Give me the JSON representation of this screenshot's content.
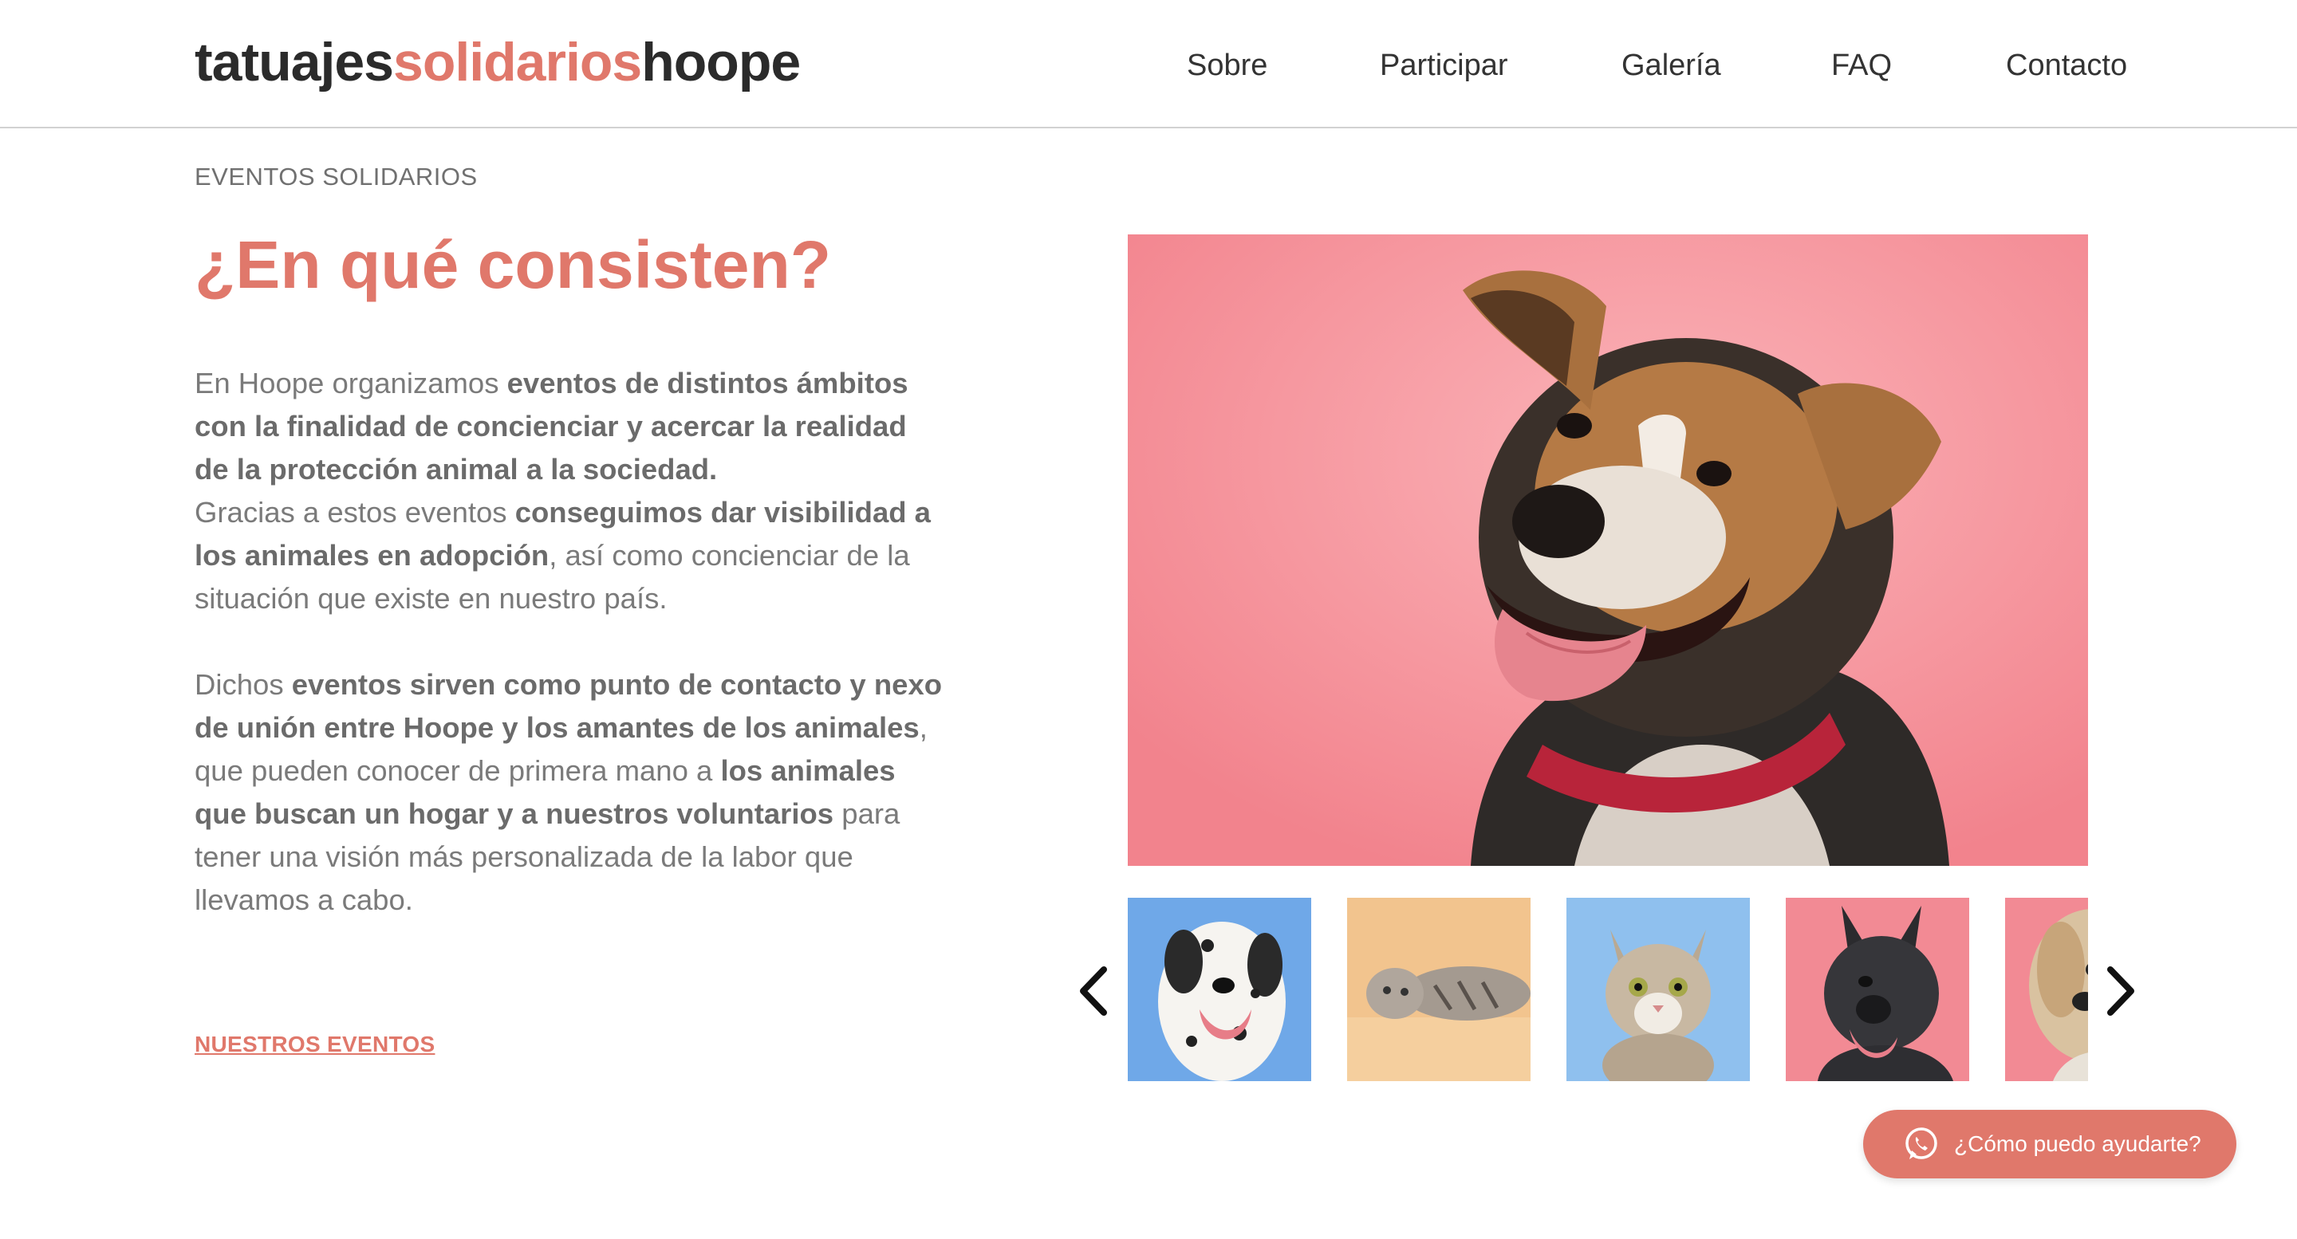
{
  "header": {
    "logo": {
      "part1": "tatuajes",
      "part2": "solidarios",
      "part3": "hoope"
    },
    "nav": [
      {
        "label": "Sobre"
      },
      {
        "label": "Participar"
      },
      {
        "label": "Galería"
      },
      {
        "label": "FAQ"
      },
      {
        "label": "Contacto"
      }
    ]
  },
  "section": {
    "eyebrow": "EVENTOS SOLIDARIOS",
    "title": "¿En qué consisten?",
    "paragraph1": {
      "t1": "En Hoope organizamos ",
      "b1": "eventos de distintos ámbitos con la finalidad de concienciar y acercar la realidad de la protección animal a la sociedad.",
      "t2": "Gracias a estos eventos ",
      "b2": "conseguimos dar visibilidad a los animales en adopción",
      "t3": ", así como concienciar de la situación que existe en nuestro país."
    },
    "paragraph2": {
      "t1": "Dichos ",
      "b1": "eventos sirven como punto de contacto y nexo de unión entre Hoope y los amantes de los animales",
      "t2": ", que pueden conocer de primera mano a ",
      "b2": "los animales que buscan un hogar y a nuestros voluntarios",
      "t3": " para tener una visión más personalizada de la labor que llevamos a cabo."
    },
    "cta": "NUESTROS EVENTOS"
  },
  "gallery": {
    "main_image": "dog-photo",
    "thumbnails": [
      "dalmatian-photo",
      "tabby-cat-lying-photo",
      "tabby-kitten-photo",
      "black-dog-photo",
      "shaggy-dog-photo"
    ],
    "prev_icon": "chevron-left-icon",
    "next_icon": "chevron-right-icon"
  },
  "chat": {
    "label": "¿Cómo puedo ayudarte?",
    "icon": "whatsapp-icon"
  },
  "colors": {
    "accent": "#e0786b",
    "text": "#7a7a7a",
    "heading": "#2b2b2b",
    "pink_bg": "#f48d96",
    "blue_bg": "#8fc0ee"
  }
}
